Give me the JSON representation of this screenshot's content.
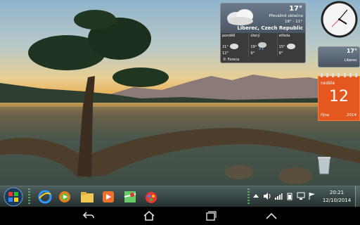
{
  "weather_gadget": {
    "temperature": "17°",
    "condition": "Převážně oblačno",
    "range": "18° - 11°",
    "city": "Liberec, Czech Republic",
    "days": [
      {
        "name": "pondělí",
        "hi": "21°",
        "lo": "12°"
      },
      {
        "name": "úterý",
        "hi": "19°",
        "lo": "9°"
      },
      {
        "name": "středa",
        "hi": "15°",
        "lo": "8°"
      }
    ],
    "brand": "© Foreca"
  },
  "mini_weather": {
    "temperature": "17°",
    "city": "Liberec"
  },
  "calendar": {
    "day_of_week": "neděle",
    "date": "12",
    "month": "října",
    "year": "2014"
  },
  "taskbar": {
    "pinned": [
      "internet-explorer-icon",
      "media-player-icon",
      "file-explorer-icon",
      "media-center-icon",
      "maps-icon",
      "paint-icon"
    ],
    "time": "20:21",
    "date": "12/10/2014"
  },
  "colors": {
    "calendar": "#e4571e",
    "taskbar": "#3a4a4a"
  }
}
